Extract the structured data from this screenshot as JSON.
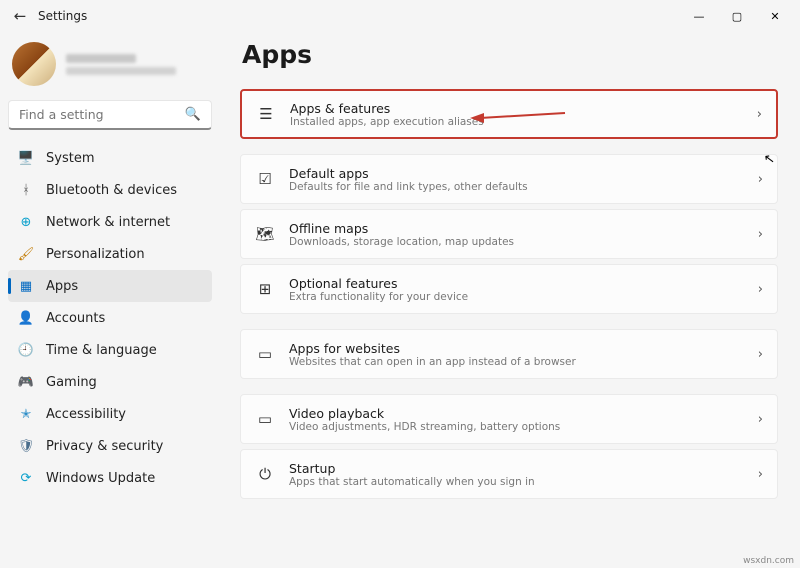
{
  "window": {
    "title": "Settings"
  },
  "search": {
    "placeholder": "Find a setting"
  },
  "nav": [
    {
      "label": "System",
      "icon": "🖥️",
      "color": "#0078d4"
    },
    {
      "label": "Bluetooth & devices",
      "icon": "ᚼ",
      "color": "#555"
    },
    {
      "label": "Network & internet",
      "icon": "⊕",
      "color": "#0aa0cc"
    },
    {
      "label": "Personalization",
      "icon": "🖌",
      "color": "#c27a00"
    },
    {
      "label": "Apps",
      "icon": "▦",
      "color": "#0067c0"
    },
    {
      "label": "Accounts",
      "icon": "👤",
      "color": "#36b36b"
    },
    {
      "label": "Time & language",
      "icon": "🕘",
      "color": "#555"
    },
    {
      "label": "Gaming",
      "icon": "🎮",
      "color": "#5b7c99"
    },
    {
      "label": "Accessibility",
      "icon": "✭",
      "color": "#2a8cc7"
    },
    {
      "label": "Privacy & security",
      "icon": "🛡",
      "color": "#4a6d8c"
    },
    {
      "label": "Windows Update",
      "icon": "⟳",
      "color": "#0aa0cc"
    }
  ],
  "page": {
    "heading": "Apps"
  },
  "items": [
    {
      "title": "Apps & features",
      "sub": "Installed apps, app execution aliases",
      "icon": "☰"
    },
    {
      "title": "Default apps",
      "sub": "Defaults for file and link types, other defaults",
      "icon": "☑"
    },
    {
      "title": "Offline maps",
      "sub": "Downloads, storage location, map updates",
      "icon": "🗺"
    },
    {
      "title": "Optional features",
      "sub": "Extra functionality for your device",
      "icon": "⊞"
    },
    {
      "title": "Apps for websites",
      "sub": "Websites that can open in an app instead of a browser",
      "icon": "▭"
    },
    {
      "title": "Video playback",
      "sub": "Video adjustments, HDR streaming, battery options",
      "icon": "▭"
    },
    {
      "title": "Startup",
      "sub": "Apps that start automatically when you sign in",
      "icon": "⏻"
    }
  ],
  "footer": "wsxdn.com"
}
